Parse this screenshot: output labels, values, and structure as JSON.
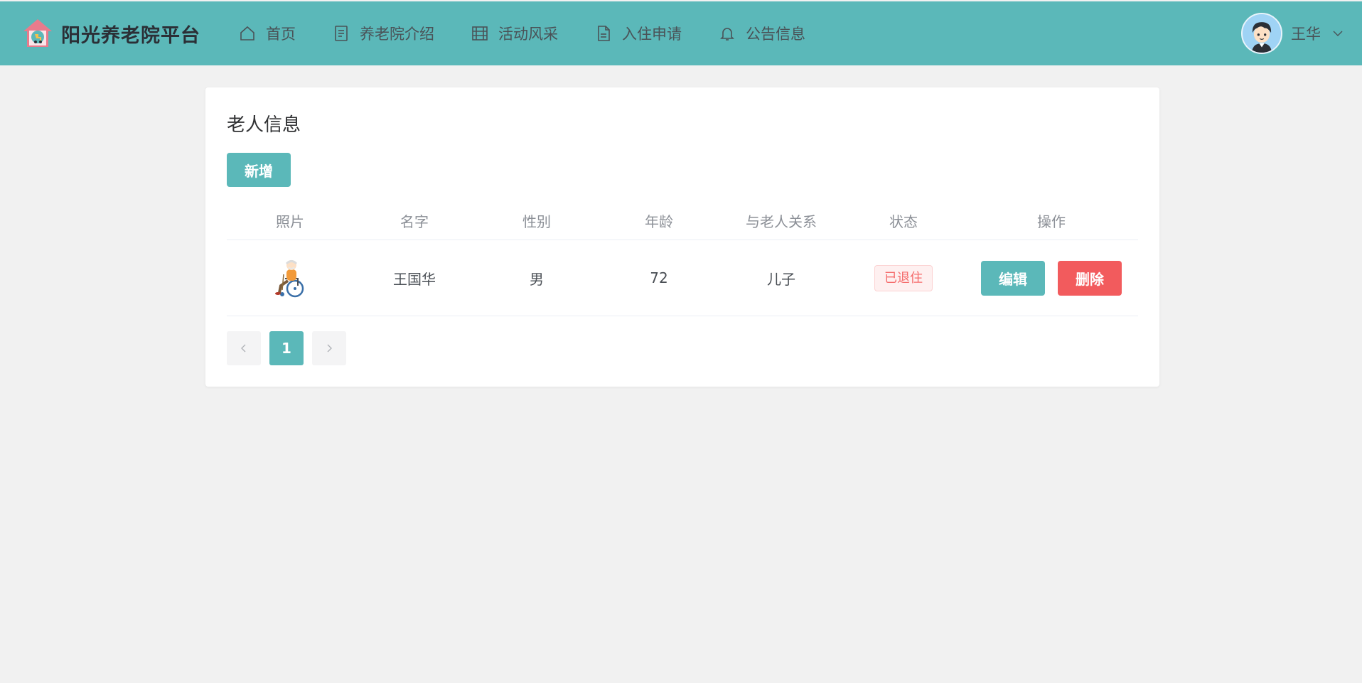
{
  "colors": {
    "header_bg": "#5bb8b9",
    "primary": "#5bb8b9",
    "danger": "#f25b5d",
    "page_bg": "#f1f1f1",
    "tag_text": "#f56c6c"
  },
  "header": {
    "brand_title": "阳光养老院平台",
    "logo_icon": "nursing-home-logo-icon",
    "nav": [
      {
        "label": "首页",
        "icon": "home-icon"
      },
      {
        "label": "养老院介绍",
        "icon": "document-icon"
      },
      {
        "label": "活动风采",
        "icon": "film-icon"
      },
      {
        "label": "入住申请",
        "icon": "file-icon"
      },
      {
        "label": "公告信息",
        "icon": "bell-icon"
      }
    ],
    "user": {
      "name": "王华",
      "avatar_icon": "avatar-icon",
      "caret_icon": "chevron-down-icon"
    }
  },
  "card": {
    "title": "老人信息",
    "add_label": "新增"
  },
  "table": {
    "columns": [
      "照片",
      "名字",
      "性别",
      "年龄",
      "与老人关系",
      "状态",
      "操作"
    ],
    "rows": [
      {
        "photo_icon": "elderly-wheelchair-icon",
        "name": "王国华",
        "gender": "男",
        "age": "72",
        "relation": "儿子",
        "status": "已退住",
        "edit_label": "编辑",
        "delete_label": "删除"
      }
    ]
  },
  "pagination": {
    "current_page": "1",
    "prev_icon": "chevron-left-icon",
    "next_icon": "chevron-right-icon"
  }
}
